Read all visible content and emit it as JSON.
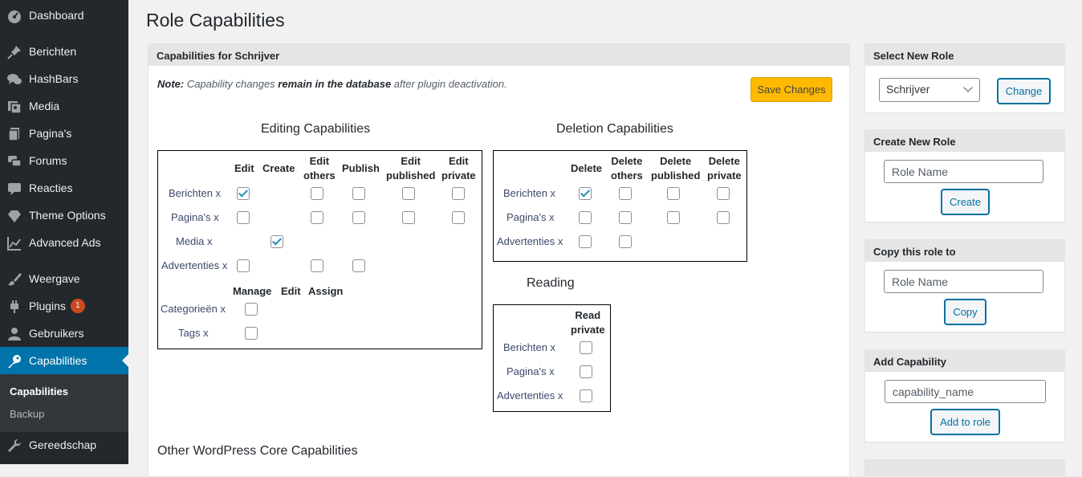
{
  "sidebar": {
    "items": [
      {
        "label": "Dashboard",
        "icon": "dashboard-icon"
      },
      {
        "label": "Berichten",
        "icon": "pin-icon"
      },
      {
        "label": "HashBars",
        "icon": "speech-bubbles-icon"
      },
      {
        "label": "Media",
        "icon": "media-icon"
      },
      {
        "label": "Pagina's",
        "icon": "pages-icon"
      },
      {
        "label": "Forums",
        "icon": "forums-icon"
      },
      {
        "label": "Reacties",
        "icon": "comment-icon"
      },
      {
        "label": "Theme Options",
        "icon": "diamond-icon"
      },
      {
        "label": "Advanced Ads",
        "icon": "chart-icon"
      },
      {
        "label": "Weergave",
        "icon": "brush-icon"
      },
      {
        "label": "Plugins",
        "icon": "plugin-icon",
        "badge": "1"
      },
      {
        "label": "Gebruikers",
        "icon": "users-icon"
      },
      {
        "label": "Capabilities",
        "icon": "key-icon"
      },
      {
        "label": "Gereedschap",
        "icon": "wrench-icon"
      }
    ],
    "submenu": [
      "Capabilities",
      "Backup"
    ]
  },
  "page_title": "Role Capabilities",
  "main": {
    "box_title": "Capabilities for Schrijver",
    "note_prefix": "Note:",
    "note_mid1": " Capability changes ",
    "note_bold": "remain in the database",
    "note_mid2": " after plugin deactivation.",
    "save_label": "Save Changes",
    "editing": {
      "title": "Editing Capabilities",
      "columns": [
        "Edit",
        "Create",
        "Edit",
        "others",
        "Publish",
        "Edit",
        "published",
        "Edit",
        "private"
      ],
      "rows": [
        "Berichten x",
        "Pagina's x",
        "Media x",
        "Advertenties x"
      ],
      "tax_columns": [
        "Manage",
        "Edit",
        "Assign"
      ],
      "tax_rows": [
        "Categorieën x",
        "Tags x"
      ]
    },
    "deletion": {
      "title": "Deletion Capabilities",
      "columns": [
        "Delete",
        "Delete",
        "others",
        "Delete",
        "published",
        "Delete",
        "private"
      ],
      "rows": [
        "Berichten x",
        "Pagina's x",
        "Advertenties x"
      ]
    },
    "reading": {
      "title": "Reading",
      "columns": [
        "Read",
        "private"
      ],
      "rows": [
        "Berichten x",
        "Pagina's x",
        "Advertenties x"
      ]
    },
    "other_title": "Other WordPress Core Capabilities"
  },
  "right": {
    "select_role": {
      "title": "Select New Role",
      "value": "Schrijver",
      "button": "Change"
    },
    "create_role": {
      "title": "Create New Role",
      "placeholder": "Role Name",
      "button": "Create"
    },
    "copy_role": {
      "title": "Copy this role to",
      "placeholder": "Role Name",
      "button": "Copy"
    },
    "add_cap": {
      "title": "Add Capability",
      "placeholder": "capability_name",
      "button": "Add to role"
    }
  },
  "colors": {
    "sidebar_bg": "#23282d",
    "active_bg": "#0073aa",
    "save_button": "#ffba00",
    "badge": "#ca4a1f"
  }
}
